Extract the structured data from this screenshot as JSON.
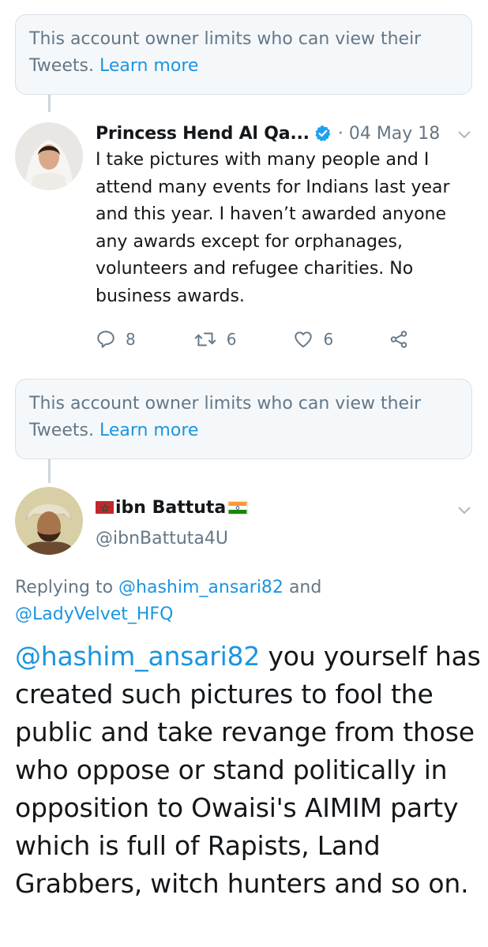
{
  "notice_top": {
    "text": "This account owner limits who can view their Tweets.",
    "link": "Learn more"
  },
  "tweet1": {
    "display_name": "Princess Hend Al Qa...",
    "verified": true,
    "date": "· 04 May 18",
    "text": "I take pictures with many people and I attend many events for Indians last year and this year. I haven’t awarded anyone any awards except for orphanages, volunteers and refugee charities. No business awards.",
    "actions": {
      "replies": "8",
      "retweets": "6",
      "likes": "6"
    }
  },
  "notice_bottom": {
    "text": "This account owner limits who can view their Tweets.",
    "link": "Learn more"
  },
  "tweet2": {
    "display_name": "ibn Battuta",
    "handle": "@ibnBattuta4U",
    "replying_label": "Replying to",
    "replying_mention1": "@hashim_ansari82",
    "replying_and": "and",
    "replying_mention2": "@LadyVelvet_HFQ",
    "mention": "@hashim_ansari82",
    "text": "you yourself has created such pictures to fool the public and take revange from those who oppose or stand politically in opposition to Owaisi's AIMIM party which is full of Rapists, Land Grabbers, witch hunters and so on."
  },
  "colors": {
    "accent": "#1b95e0",
    "muted": "#657786",
    "verified": "#1da1f2",
    "notice_bg": "#f5f8fa"
  }
}
